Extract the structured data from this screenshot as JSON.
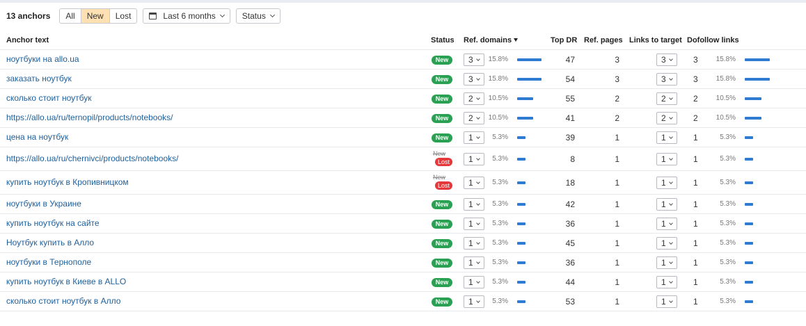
{
  "toolbar": {
    "count_label": "13 anchors",
    "filters": [
      {
        "label": "All",
        "active": false
      },
      {
        "label": "New",
        "active": true
      },
      {
        "label": "Lost",
        "active": false
      }
    ],
    "date_range": "Last 6 months",
    "status_dropdown": "Status"
  },
  "columns": {
    "anchor": "Anchor text",
    "status": "Status",
    "ref_domains": "Ref. domains",
    "top_dr": "Top DR",
    "ref_pages": "Ref. pages",
    "links_to_target": "Links to target",
    "dofollow": "Dofollow links"
  },
  "status_labels": {
    "new": "New",
    "lost": "Lost"
  },
  "colors": {
    "accent_bar": "#2f7bd1",
    "new_badge": "#2aa152",
    "lost_badge": "#e5383b",
    "active_filter": "#ffe0b3",
    "link": "#1d5f9b"
  },
  "rows": [
    {
      "anchor": "ноутбуки на allo.ua",
      "status": "new",
      "ref_domains": "3",
      "ref_pct": "15.8%",
      "ref_share": 15.8,
      "top_dr": "47",
      "ref_pages": "3",
      "links": "3",
      "dofollow": "3",
      "do_pct": "15.8%",
      "do_share": 15.8
    },
    {
      "anchor": "заказать ноутбук",
      "status": "new",
      "ref_domains": "3",
      "ref_pct": "15.8%",
      "ref_share": 15.8,
      "top_dr": "54",
      "ref_pages": "3",
      "links": "3",
      "dofollow": "3",
      "do_pct": "15.8%",
      "do_share": 15.8
    },
    {
      "anchor": "сколько стоит ноутбук",
      "status": "new",
      "ref_domains": "2",
      "ref_pct": "10.5%",
      "ref_share": 10.5,
      "top_dr": "55",
      "ref_pages": "2",
      "links": "2",
      "dofollow": "2",
      "do_pct": "10.5%",
      "do_share": 10.5
    },
    {
      "anchor": "https://allo.ua/ru/ternopil/products/notebooks/",
      "status": "new",
      "ref_domains": "2",
      "ref_pct": "10.5%",
      "ref_share": 10.5,
      "top_dr": "41",
      "ref_pages": "2",
      "links": "2",
      "dofollow": "2",
      "do_pct": "10.5%",
      "do_share": 10.5
    },
    {
      "anchor": "цена на ноутбук",
      "status": "new",
      "ref_domains": "1",
      "ref_pct": "5.3%",
      "ref_share": 5.3,
      "top_dr": "39",
      "ref_pages": "1",
      "links": "1",
      "dofollow": "1",
      "do_pct": "5.3%",
      "do_share": 5.3
    },
    {
      "anchor": "https://allo.ua/ru/chernivci/products/notebooks/",
      "status": "lost",
      "ref_domains": "1",
      "ref_pct": "5.3%",
      "ref_share": 5.3,
      "top_dr": "8",
      "ref_pages": "1",
      "links": "1",
      "dofollow": "1",
      "do_pct": "5.3%",
      "do_share": 5.3
    },
    {
      "anchor": "купить ноутбук в Кропивницком",
      "status": "lost",
      "ref_domains": "1",
      "ref_pct": "5.3%",
      "ref_share": 5.3,
      "top_dr": "18",
      "ref_pages": "1",
      "links": "1",
      "dofollow": "1",
      "do_pct": "5.3%",
      "do_share": 5.3
    },
    {
      "anchor": "ноутбуки в Украине",
      "status": "new",
      "ref_domains": "1",
      "ref_pct": "5.3%",
      "ref_share": 5.3,
      "top_dr": "42",
      "ref_pages": "1",
      "links": "1",
      "dofollow": "1",
      "do_pct": "5.3%",
      "do_share": 5.3
    },
    {
      "anchor": "купить ноутбук на сайте",
      "status": "new",
      "ref_domains": "1",
      "ref_pct": "5.3%",
      "ref_share": 5.3,
      "top_dr": "36",
      "ref_pages": "1",
      "links": "1",
      "dofollow": "1",
      "do_pct": "5.3%",
      "do_share": 5.3
    },
    {
      "anchor": "Ноутбук купить в Алло",
      "status": "new",
      "ref_domains": "1",
      "ref_pct": "5.3%",
      "ref_share": 5.3,
      "top_dr": "45",
      "ref_pages": "1",
      "links": "1",
      "dofollow": "1",
      "do_pct": "5.3%",
      "do_share": 5.3
    },
    {
      "anchor": "ноутбуки в Тернополе",
      "status": "new",
      "ref_domains": "1",
      "ref_pct": "5.3%",
      "ref_share": 5.3,
      "top_dr": "36",
      "ref_pages": "1",
      "links": "1",
      "dofollow": "1",
      "do_pct": "5.3%",
      "do_share": 5.3
    },
    {
      "anchor": "купить ноутбук в Киеве в ALLO",
      "status": "new",
      "ref_domains": "1",
      "ref_pct": "5.3%",
      "ref_share": 5.3,
      "top_dr": "44",
      "ref_pages": "1",
      "links": "1",
      "dofollow": "1",
      "do_pct": "5.3%",
      "do_share": 5.3
    },
    {
      "anchor": "сколько стоит ноутбук в Алло",
      "status": "new",
      "ref_domains": "1",
      "ref_pct": "5.3%",
      "ref_share": 5.3,
      "top_dr": "53",
      "ref_pages": "1",
      "links": "1",
      "dofollow": "1",
      "do_pct": "5.3%",
      "do_share": 5.3
    }
  ]
}
